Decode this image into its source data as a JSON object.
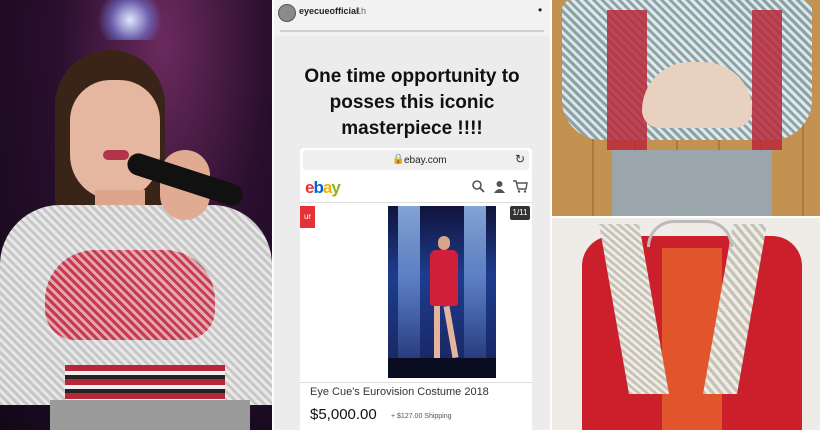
{
  "story": {
    "username": "eyecueofficial",
    "time": "1h",
    "more": "•",
    "headline": "One time opportunity to posses this iconic masterpiece !!!!"
  },
  "browser": {
    "lock": "🔒",
    "url": "ebay.com",
    "reload": "↻"
  },
  "ebay": {
    "logo_e": "e",
    "logo_b": "b",
    "logo_a": "a",
    "logo_y": "y",
    "ribbon": "ur",
    "counter": "1/11",
    "item_title": "Eye Cue's Eurovision Costume 2018",
    "price": "$5,000.00",
    "shipping": "+ $127.00 Shipping"
  },
  "icons": {
    "search": "search-icon",
    "account": "user-icon",
    "cart": "cart-icon"
  },
  "colors": {
    "ebay_red": "#e53238",
    "ebay_blue": "#0064d2",
    "ebay_yellow": "#f5af02",
    "ebay_green": "#86b817"
  }
}
